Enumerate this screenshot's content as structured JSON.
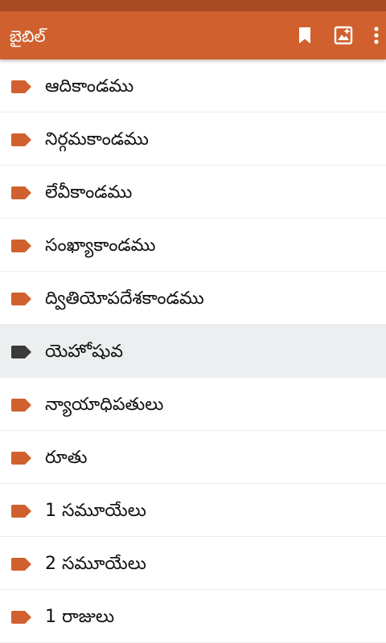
{
  "app": {
    "title": "బైబిల్",
    "accent_color": "#d0612f",
    "status_bar_color": "#a84a24"
  },
  "toolbar": {
    "bookmark_icon": "bookmark-icon",
    "export_icon": "export-image-icon",
    "more_icon": "more-vert-icon"
  },
  "books": {
    "items": [
      {
        "label": "ఆదికాండము",
        "tag_color": "#d0612f"
      },
      {
        "label": "నిర్గమకాండము",
        "tag_color": "#d0612f"
      },
      {
        "label": "లేవీకాండము",
        "tag_color": "#d0612f"
      },
      {
        "label": "సంఖ్యాకాండము",
        "tag_color": "#d0612f"
      },
      {
        "label": "ద్వితియోపదేశకాండము",
        "tag_color": "#d0612f"
      },
      {
        "label": "యెహోషువ",
        "tag_color": "#3a3a3a",
        "selected": true
      },
      {
        "label": "న్యాయాధిపతులు",
        "tag_color": "#d0612f"
      },
      {
        "label": "రూతు",
        "tag_color": "#d0612f"
      },
      {
        "label": "1 సమూయేలు",
        "tag_color": "#d0612f"
      },
      {
        "label": "2 సమూయేలు",
        "tag_color": "#d0612f"
      },
      {
        "label": "1 రాజులు",
        "tag_color": "#d0612f"
      }
    ]
  }
}
